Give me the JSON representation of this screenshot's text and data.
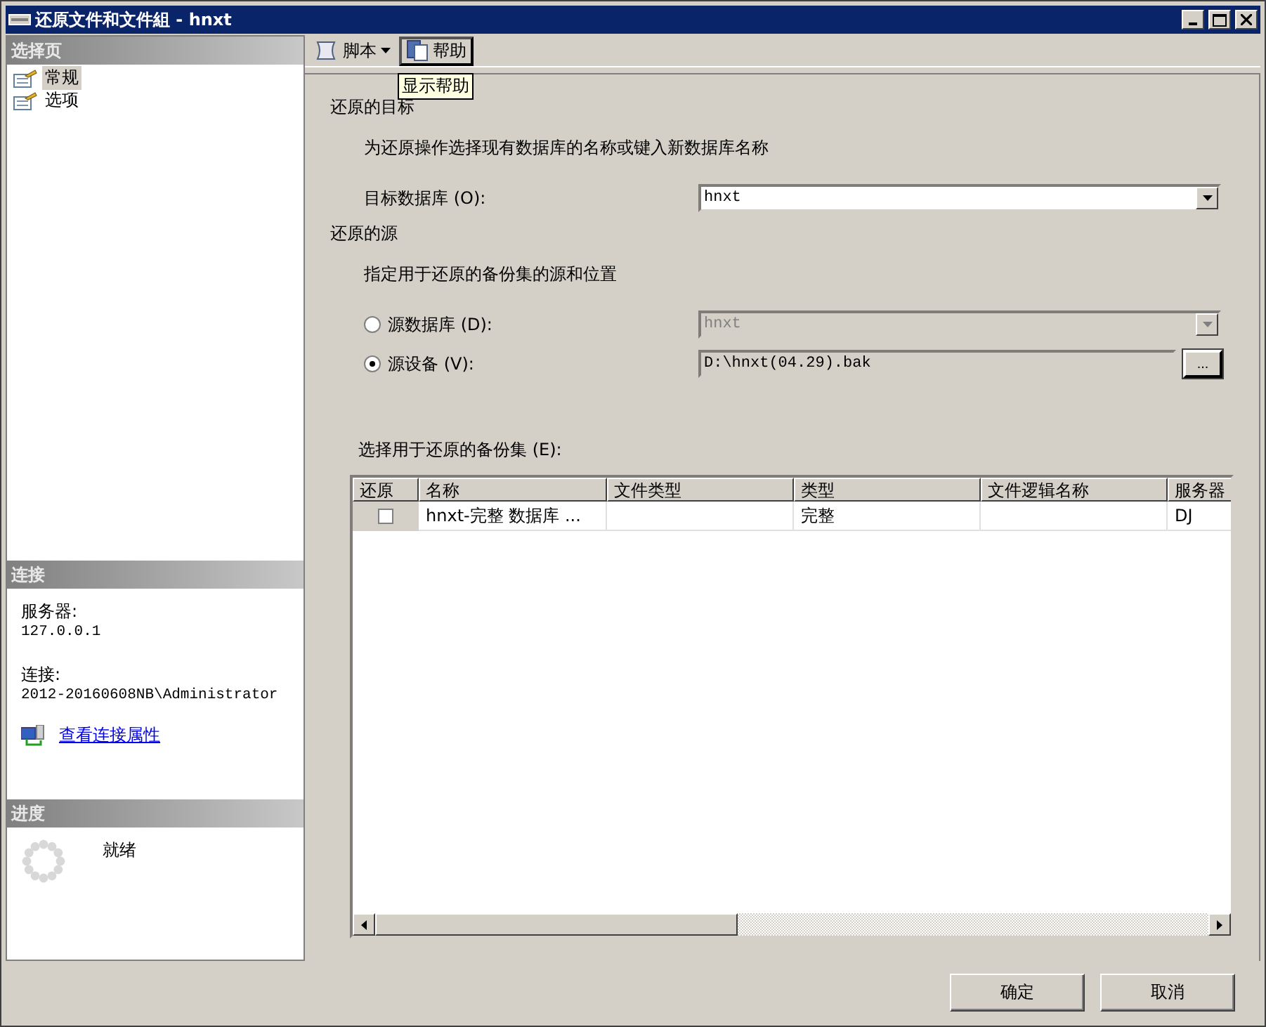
{
  "window": {
    "title": "还原文件和文件組 - hnxt"
  },
  "sidebar": {
    "header": "选择页",
    "pages": [
      {
        "label": "常规",
        "selected": true
      },
      {
        "label": "选项",
        "selected": false
      }
    ],
    "connection": {
      "header": "连接",
      "server_label": "服务器:",
      "server": "127.0.0.1",
      "connection_label": "连接:",
      "connection": "2012-20160608NB\\Administrator",
      "link": "查看连接属性"
    },
    "progress": {
      "header": "进度",
      "status": "就绪"
    }
  },
  "toolbar": [
    {
      "kind": "dropdown",
      "label": "脚本"
    },
    {
      "kind": "button",
      "label": "帮助"
    }
  ],
  "tooltip": "显示帮助",
  "destination": {
    "heading": "还原的目标",
    "description": "为还原操作选择现有数据库的名称或键入新数据库名称",
    "database_label": "目标数据库 (O):",
    "database_value": "hnxt"
  },
  "source": {
    "heading": "还原的源",
    "description": "指定用于还原的备份集的源和位置",
    "options": [
      {
        "kind": "database",
        "label": "源数据库 (D):",
        "value": "hnxt",
        "selected": false
      },
      {
        "kind": "device",
        "label": "源设备 (V):",
        "value": "D:\\hnxt(04.29).bak",
        "selected": true,
        "browse": "..."
      }
    ]
  },
  "backup_sets": {
    "label": "选择用于还原的备份集 (E):",
    "columns": [
      "还原",
      "名称",
      "文件类型",
      "类型",
      "文件逻辑名称",
      "服务器"
    ],
    "rows": [
      {
        "restore": false,
        "cells": [
          "",
          "hnxt-完整 数据库 ...",
          "",
          "完整",
          "",
          "DJ"
        ]
      }
    ]
  },
  "buttons": [
    "确定",
    "取消"
  ]
}
